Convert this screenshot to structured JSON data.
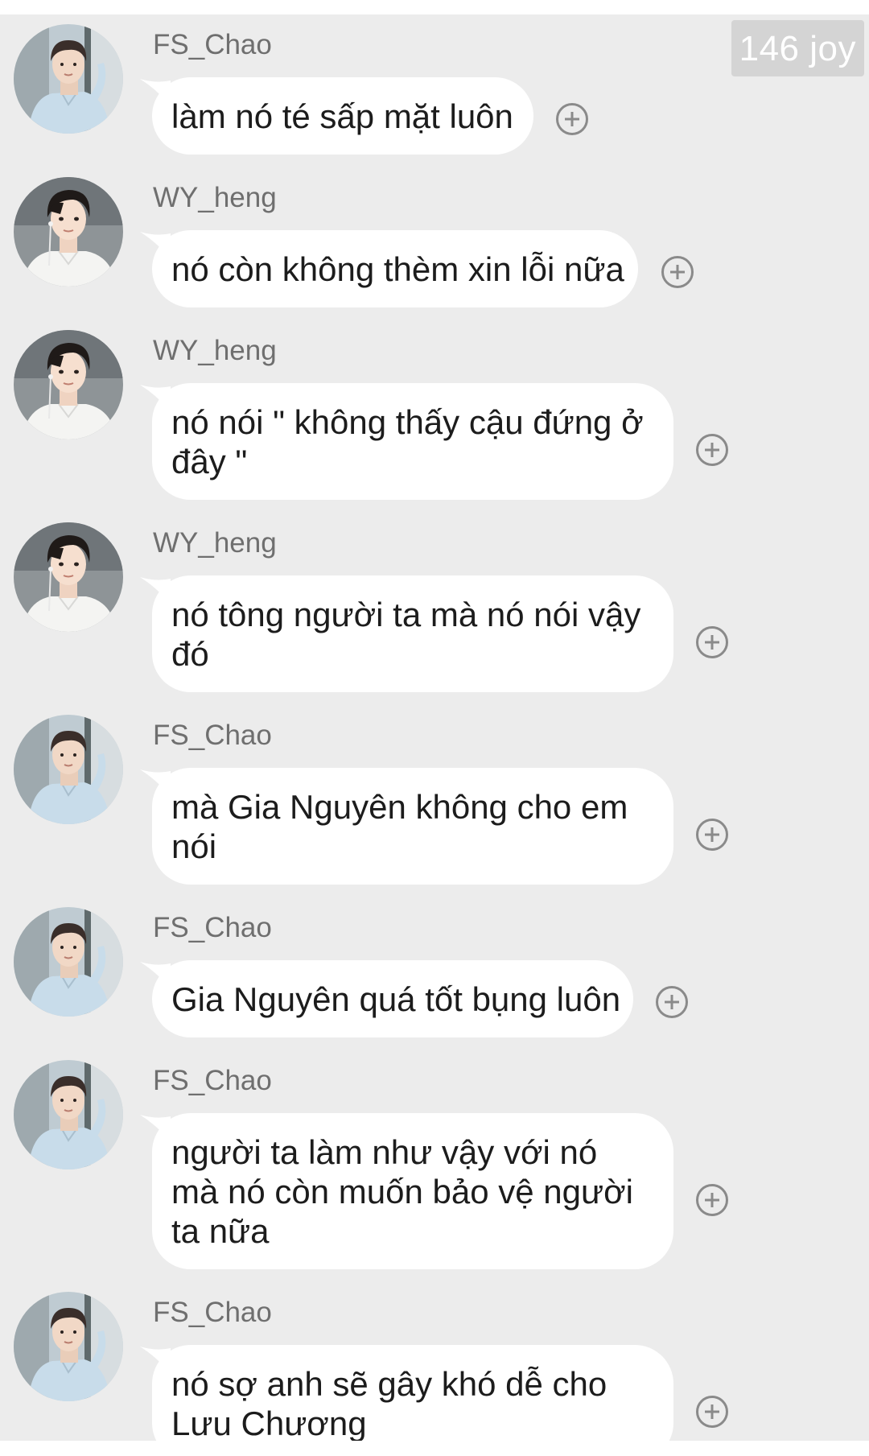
{
  "watermark": "146 joy",
  "avatars": {
    "FS_Chao": "avatar-light-blue-hoodie",
    "WY_heng": "avatar-white-shirt-earphones"
  },
  "colors": {
    "background": "#ececec",
    "bubble": "#ffffff",
    "sender_name": "#6f6f6f",
    "text": "#1c1c1c",
    "add_icon": "#8a8a8a"
  },
  "messages": [
    {
      "sender": "FS_Chao",
      "text": "làm nó té sấp mặt luôn",
      "action_icon": "plus-circle-icon"
    },
    {
      "sender": "WY_heng",
      "text": "nó còn không thèm xin lỗi nữa",
      "action_icon": "plus-circle-icon"
    },
    {
      "sender": "WY_heng",
      "text": "nó nói \" không thấy cậu đứng ở đây \"",
      "action_icon": "plus-circle-icon"
    },
    {
      "sender": "WY_heng",
      "text": "nó tông người ta mà nó nói vậy đó",
      "action_icon": "plus-circle-icon"
    },
    {
      "sender": "FS_Chao",
      "text": "mà Gia Nguyên không cho em nói",
      "action_icon": "plus-circle-icon"
    },
    {
      "sender": "FS_Chao",
      "text": "Gia Nguyên quá tốt bụng luôn",
      "action_icon": "plus-circle-icon"
    },
    {
      "sender": "FS_Chao",
      "text": "người ta làm như vậy với nó mà nó còn muốn bảo vệ người ta nữa",
      "action_icon": "plus-circle-icon"
    },
    {
      "sender": "FS_Chao",
      "text": "nó sợ anh sẽ gây khó dễ cho Lưu Chương",
      "action_icon": "plus-circle-icon"
    }
  ]
}
